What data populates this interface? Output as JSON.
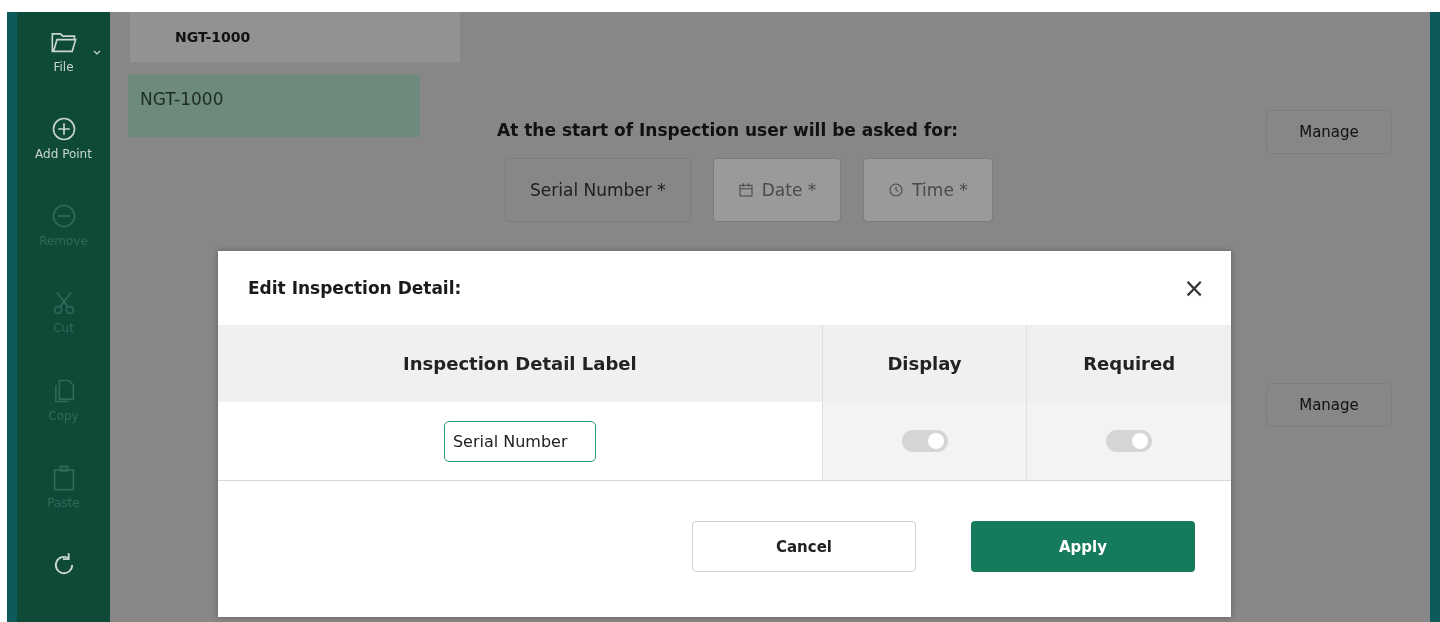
{
  "sidebar": {
    "items": [
      {
        "kind": "file",
        "label": "File",
        "disabled": false
      },
      {
        "kind": "add",
        "label": "Add Point",
        "disabled": false
      },
      {
        "kind": "remove",
        "label": "Remove",
        "disabled": true
      },
      {
        "kind": "cut",
        "label": "Cut",
        "disabled": true
      },
      {
        "kind": "copy",
        "label": "Copy",
        "disabled": true
      },
      {
        "kind": "paste",
        "label": "Paste",
        "disabled": true
      },
      {
        "kind": "refresh",
        "disabled": false
      }
    ]
  },
  "tabs": [
    {
      "label": "NGT-1000",
      "selected": true
    }
  ],
  "list": {
    "items": [
      {
        "label": "NGT-1000",
        "selected": true
      }
    ]
  },
  "section": {
    "title": "At the start of Inspection user will be asked for:",
    "fields": [
      {
        "kind": "text",
        "label": "Serial Number *",
        "disabled": false
      },
      {
        "kind": "date",
        "label": "Date *",
        "disabled": true
      },
      {
        "kind": "time",
        "label": "Time *",
        "disabled": true
      }
    ],
    "manage_buttons": [
      "Manage",
      "Manage"
    ]
  },
  "dialog": {
    "title": "Edit Inspection Detail:",
    "close": "×",
    "columns": [
      "Inspection Detail Label",
      "Display",
      "Required"
    ],
    "rows": [
      {
        "value": "Serial Number",
        "display": {
          "on": true,
          "disabled": true
        },
        "required": {
          "on": true,
          "disabled": true
        }
      }
    ],
    "buttons": [
      {
        "kind": "secondary",
        "label": "Cancel"
      },
      {
        "kind": "primary",
        "label": "Apply"
      }
    ]
  }
}
